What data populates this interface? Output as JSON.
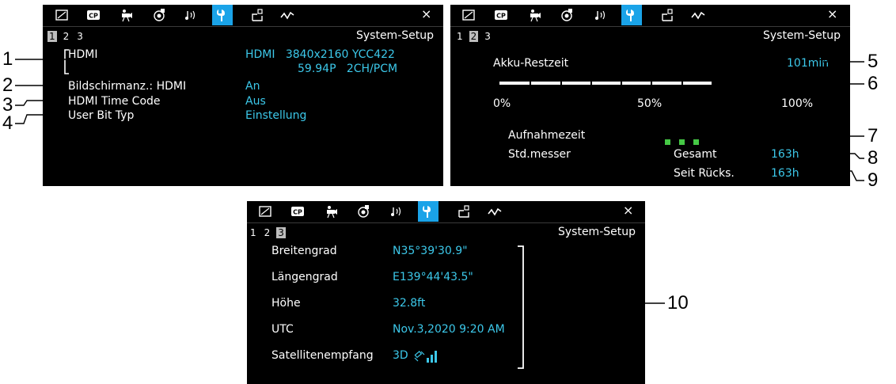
{
  "tabs": [
    "photo-icon",
    "cp-icon",
    "camera-setup-icon",
    "record-icon",
    "audio-icon",
    "wrench-icon",
    "assign-icon",
    "waveform-icon"
  ],
  "close_label": "×",
  "page_numbers": [
    "1",
    "2",
    "3"
  ],
  "screen_title": "System-Setup",
  "screen1": {
    "hdmi_label": "HDMI",
    "hdmi_value_line1": "HDMI   3840x2160 YCC422",
    "hdmi_value_line2": "59.94P   2CH/PCM",
    "display_label": "Bildschirmanz.: HDMI",
    "display_value": "An",
    "timecode_label": "HDMI Time Code",
    "timecode_value": "Aus",
    "userbit_label": "User Bit Typ",
    "userbit_value": "Einstellung"
  },
  "screen2": {
    "battery_label": "Akku-Restzeit",
    "battery_value": "101min",
    "battery_level_fraction": 0.7,
    "scale_0": "0%",
    "scale_50": "50%",
    "scale_100": "100%",
    "rec_time_label": "Aufnahmezeit",
    "hour_meter_label": "Std.messer",
    "total_label": "Gesamt",
    "total_value": "163h",
    "since_reset_label": "Seit Rücks.",
    "since_reset_value": "163h"
  },
  "screen3": {
    "rows": [
      {
        "label": "Breitengrad",
        "value": "N35°39'30.9\""
      },
      {
        "label": "Längengrad",
        "value": "E139°44'43.5\""
      },
      {
        "label": "Höhe",
        "value": "32.8ft"
      },
      {
        "label": "UTC",
        "value": "Nov.3,2020 9:20 AM"
      },
      {
        "label": "Satellitenempfang",
        "value": "3D"
      }
    ]
  },
  "callouts": [
    "1",
    "2",
    "3",
    "4",
    "5",
    "6",
    "7",
    "8",
    "9",
    "10"
  ],
  "colors": {
    "value_cyan": "#3cc8ea",
    "tab_active": "#1aa3e8",
    "green": "#45c845"
  }
}
